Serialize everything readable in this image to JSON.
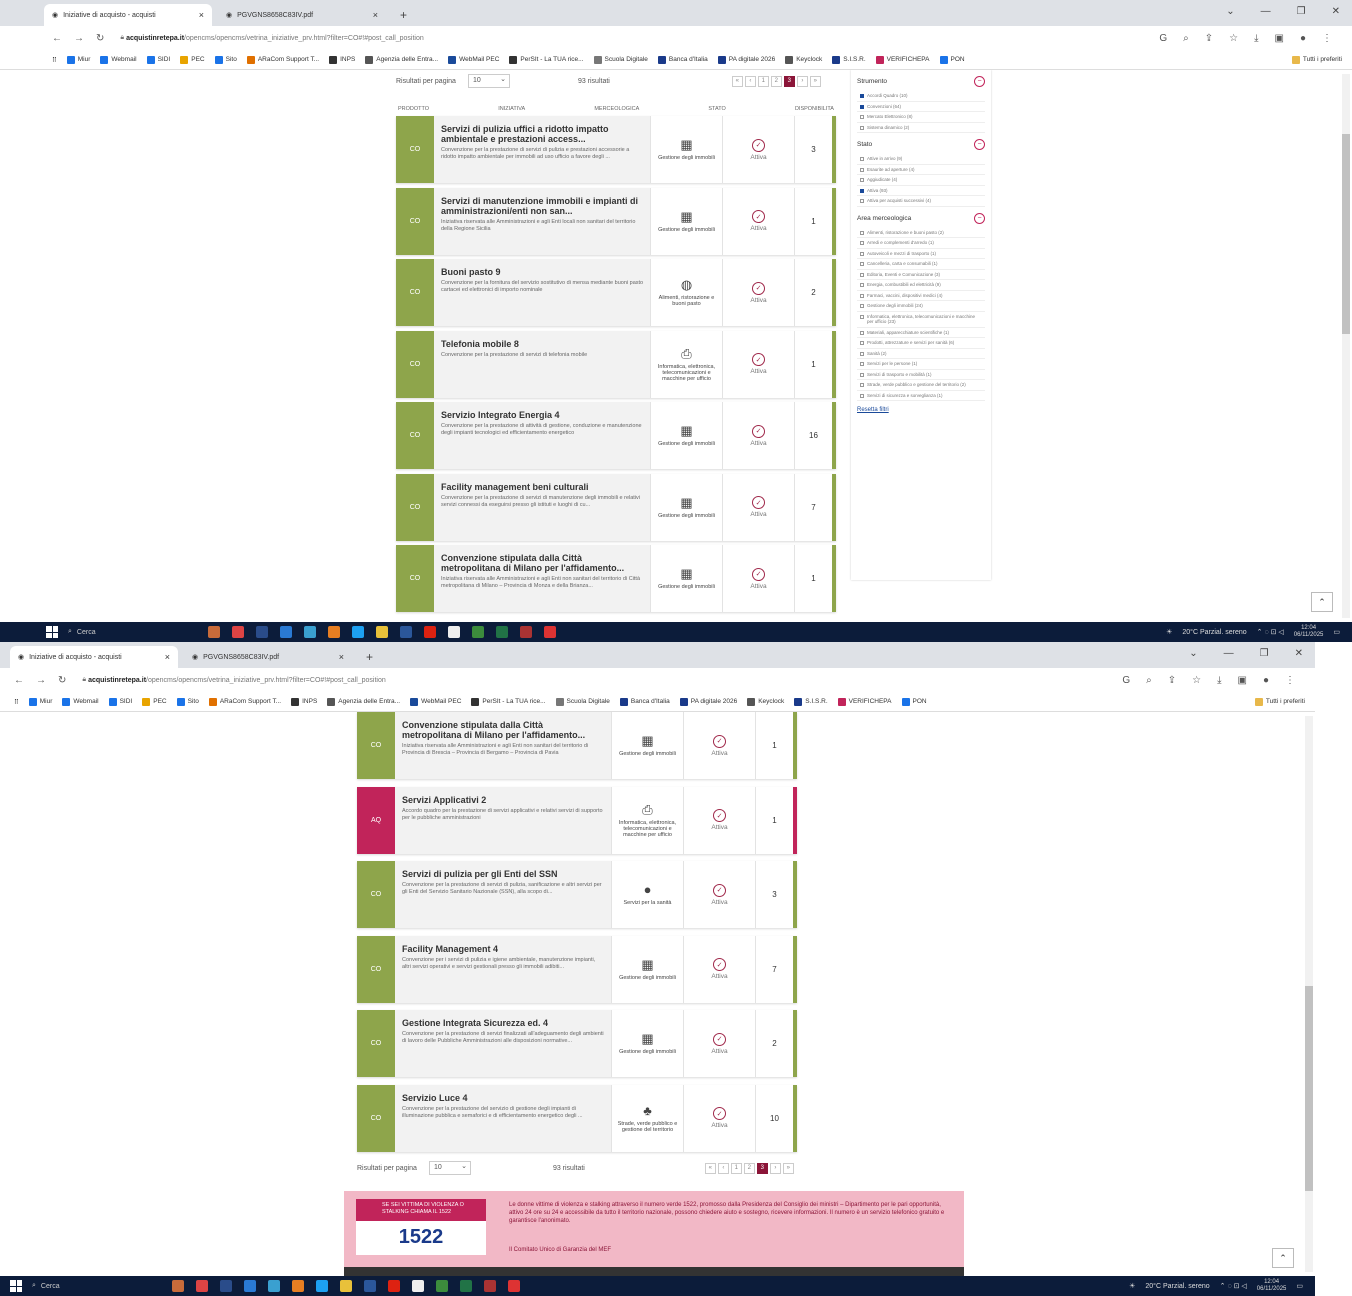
{
  "browser": {
    "tabs": [
      {
        "label": "Iniziative di acquisto - acquisti"
      },
      {
        "label": "PGVGNS8658C83IV.pdf"
      }
    ],
    "tabs_s2": [
      {
        "label": "Iniziative di acquisto - acquisti"
      },
      {
        "label": "PGVGNS8658C83IV.pdf"
      }
    ],
    "url_host": "acquistinretepa.it",
    "url_path": "/opencms/opencms/vetrina_iniziative_prv.html?filter=CO#!#post_call_position",
    "bookmarks": [
      {
        "label": "Miur",
        "color": "#1a73e8"
      },
      {
        "label": "Webmail",
        "color": "#1a73e8"
      },
      {
        "label": "SIDI",
        "color": "#1a73e8"
      },
      {
        "label": "PEC",
        "color": "#e8a400"
      },
      {
        "label": "Sito",
        "color": "#1a73e8"
      },
      {
        "label": "ARaCom Support T...",
        "color": "#e07000"
      },
      {
        "label": "INPS",
        "color": "#333333"
      },
      {
        "label": "Agenzia delle Entra...",
        "color": "#555555"
      },
      {
        "label": "WebMail PEC",
        "color": "#1a4a9a"
      },
      {
        "label": "PerSIt - La TUA rice...",
        "color": "#333333"
      },
      {
        "label": "Scuola Digitale",
        "color": "#777777"
      },
      {
        "label": "Banca d'Italia",
        "color": "#1a3a8a"
      },
      {
        "label": "PA digitale 2026",
        "color": "#1a3a8a"
      },
      {
        "label": "Keyclock",
        "color": "#555555"
      },
      {
        "label": "S.I.S.R.",
        "color": "#1a3a8a"
      },
      {
        "label": "VERIFICHEPA",
        "color": "#c1245a"
      },
      {
        "label": "PON",
        "color": "#1a73e8"
      }
    ],
    "bookmarks_right": "Tutti i preferiti"
  },
  "page1": {
    "per_page_label": "Risultati per pagina",
    "per_page_value": "10",
    "results": "93 risultati",
    "pages": [
      "«",
      "‹",
      "1",
      "2",
      "3",
      "›",
      "»"
    ],
    "columns": [
      "PRODOTTO",
      "INIZIATIVA",
      "MERCEOLOGICA",
      "STATO",
      "DISPONIBILITA"
    ],
    "cards": [
      {
        "tag": "CO",
        "title": "Servizi di pulizia uffici a ridotto impatto ambientale e prestazioni access...",
        "desc": "Convenzione per la prestazione di servizi di pulizia e prestazioni accessorie a ridotto impatto ambientale per immobili ad uso ufficio a favore degli ...",
        "cat_icon": "▦",
        "cat": "Gestione degli immobili",
        "status": "Attiva",
        "num": "3"
      },
      {
        "tag": "CO",
        "title": "Servizi di manutenzione immobili e impianti di amministrazioni/enti non san...",
        "desc": "Iniziativa riservata alle Amministrazioni e agli Enti locali non sanitari del territorio della Regione Sicilia",
        "cat_icon": "▦",
        "cat": "Gestione degli immobili",
        "status": "Attiva",
        "num": "1"
      },
      {
        "tag": "CO",
        "title": "Buoni pasto 9",
        "desc": "Convenzione per la fornitura del servizio sostitutivo di mensa mediante buoni pasto cartacei ed elettronici di importo nominale",
        "cat_icon": "◍",
        "cat": "Alimenti, ristorazione e buoni pasto",
        "status": "Attiva",
        "num": "2"
      },
      {
        "tag": "CO",
        "title": "Telefonia mobile 8",
        "desc": "Convenzione per la prestazione di servizi di telefonia mobile",
        "cat_icon": "⎙",
        "cat": "Informatica, elettronica, telecomunicazioni e macchine per ufficio",
        "status": "Attiva",
        "num": "1"
      },
      {
        "tag": "CO",
        "title": "Servizio Integrato Energia 4",
        "desc": "Convenzione per la prestazione di attività di gestione, conduzione e manutenzione degli impianti tecnologici ed efficientamento energetico",
        "cat_icon": "▦",
        "cat": "Gestione degli immobili",
        "status": "Attiva",
        "num": "16"
      },
      {
        "tag": "CO",
        "title": "Facility management beni culturali",
        "desc": "Convenzione per la prestazione di servizi di manutenzione degli immobili e relativi servizi connessi da eseguirsi presso gli istituti e luoghi di cu...",
        "cat_icon": "▦",
        "cat": "Gestione degli immobili",
        "status": "Attiva",
        "num": "7"
      },
      {
        "tag": "CO",
        "title": "Convenzione stipulata dalla Città metropolitana di Milano per l'affidamento...",
        "desc": "Iniziativa riservata alle Amministrazioni e agli Enti non sanitari del territorio di Città metropolitana di Milano – Provincia di Monza e della Brianza...",
        "cat_icon": "▦",
        "cat": "Gestione degli immobili",
        "status": "Attiva",
        "num": "1"
      }
    ],
    "filters": [
      {
        "head": "Strumento",
        "opts": [
          {
            "t": "Accordi Quadro (10)",
            "on": true
          },
          {
            "t": "Convenzioni (64)",
            "on": true
          },
          {
            "t": "Mercato Elettronico (8)",
            "on": false
          },
          {
            "t": "Sistema dinamico (2)",
            "on": false
          }
        ]
      },
      {
        "head": "Stato",
        "opts": [
          {
            "t": "Attive in arrivo (9)",
            "on": false
          },
          {
            "t": "Esaurite ad aperture (4)",
            "on": false
          },
          {
            "t": "Aggiudicate (4)",
            "on": false
          },
          {
            "t": "Attiva (93)",
            "on": true
          },
          {
            "t": "Attiva per acquisti successivi (4)",
            "on": false
          }
        ]
      },
      {
        "head": "Area merceologica",
        "opts": [
          {
            "t": "Alimenti, ristorazione e buoni pasto (2)",
            "on": false
          },
          {
            "t": "Arredi e complementi d'arredo (1)",
            "on": false
          },
          {
            "t": "Autoveicoli e mezzi di trasporto (1)",
            "on": false
          },
          {
            "t": "Cancelleria, carta e consumabili (1)",
            "on": false
          },
          {
            "t": "Editoria, Eventi e Comunicazione (3)",
            "on": false
          },
          {
            "t": "Energia, combustibili ed elettricità (9)",
            "on": false
          },
          {
            "t": "Farmaci, vaccini, dispositivi medici (4)",
            "on": false
          },
          {
            "t": "Gestione degli immobili (24)",
            "on": false
          },
          {
            "t": "Informatica, elettronica, telecomunicazioni e macchine per ufficio (23)",
            "on": false
          },
          {
            "t": "Materiali, apparecchiature scientifiche (1)",
            "on": false
          },
          {
            "t": "Prodotti, attrezzature e servizi per sanità (6)",
            "on": false
          },
          {
            "t": "Sanità (2)",
            "on": false
          },
          {
            "t": "Servizi per le persone (1)",
            "on": false
          },
          {
            "t": "Servizi di trasporto e mobilità (1)",
            "on": false
          },
          {
            "t": "Strade, verde pubblico e gestione del territorio (2)",
            "on": false
          },
          {
            "t": "Servizi di sicurezza e sorveglianza (1)",
            "on": false
          }
        ]
      }
    ],
    "reset": "Resetta filtri"
  },
  "page2": {
    "per_page_label": "Risultati per pagina",
    "per_page_value": "10",
    "results": "93 risultati",
    "pages": [
      "«",
      "‹",
      "1",
      "2",
      "3",
      "›",
      "»"
    ],
    "cards": [
      {
        "tag": "CO",
        "title": "Convenzione stipulata dalla Città metropolitana di Milano per l'affidamento...",
        "desc": "Iniziativa riservata alle Amministrazioni e agli Enti non sanitari del territorio di Provincia di Brescia – Provincia di Bergamo – Provincia di Pavia",
        "cat_icon": "▦",
        "cat": "Gestione degli immobili",
        "status": "Attiva",
        "num": "1",
        "type": "co"
      },
      {
        "tag": "AQ",
        "title": "Servizi Applicativi 2",
        "desc": "Accordo quadro per la prestazione di servizi applicativi e relativi servizi di supporto per le pubbliche amministrazioni",
        "cat_icon": "⎙",
        "cat": "Informatica, elettronica, telecomunicazioni e macchine per ufficio",
        "status": "Attiva",
        "num": "1",
        "type": "aq"
      },
      {
        "tag": "CO",
        "title": "Servizi di pulizia per gli Enti del SSN",
        "desc": "Convenzione per la prestazione di servizi di pulizia, sanificazione e altri servizi per gli Enti del Servizio Sanitario Nazionale (SSN), alla scopo di...",
        "cat_icon": "●",
        "cat": "Servizi per la sanità",
        "status": "Attiva",
        "num": "3",
        "type": "co"
      },
      {
        "tag": "CO",
        "title": "Facility Management 4",
        "desc": "Convenzione per i servizi di pulizia e igiene ambientale, manutenzione impianti, altri servizi operativi e servizi gestionali presso gli immobili adibiti...",
        "cat_icon": "▦",
        "cat": "Gestione degli immobili",
        "status": "Attiva",
        "num": "7",
        "type": "co"
      },
      {
        "tag": "CO",
        "title": "Gestione Integrata Sicurezza ed. 4",
        "desc": "Convenzione per la prestazione di servizi finalizzati all'adeguamento degli ambienti di lavoro delle Pubbliche Amministrazioni alle disposizioni normative...",
        "cat_icon": "▦",
        "cat": "Gestione degli immobili",
        "status": "Attiva",
        "num": "2",
        "type": "co"
      },
      {
        "tag": "CO",
        "title": "Servizio Luce 4",
        "desc": "Convenzione per la prestazione del servizio di gestione degli impianti di illuminazione pubblica e semaforici e di efficientamento energetico degli ...",
        "cat_icon": "♣",
        "cat": "Strade, verde pubblico e gestione del territorio",
        "status": "Attiva",
        "num": "10",
        "type": "co"
      }
    ],
    "banner": {
      "logo_top": "SE SEI VITTIMA DI VIOLENZA O STALKING CHIAMA IL 1522",
      "logo_num": "1522",
      "text": "Le donne vittime di violenza e stalking attraverso il numero verde 1522, promosso dalla Presidenza del Consiglio dei ministri – Dipartimento per le pari opportunità, attivo 24 ore su 24 e accessibile da tutto il territorio nazionale, possono chiedere aiuto e sostegno, ricevere informazioni. Il numero è un servizio telefonico gratuito e garantisce l'anonimato.",
      "signature": "Il Comitato Unico di Garanzia del MEF"
    }
  },
  "taskbar": {
    "search": "Cerca",
    "weather": "20°C Parzial. sereno",
    "time": "12:04",
    "date": "06/11/2025"
  }
}
